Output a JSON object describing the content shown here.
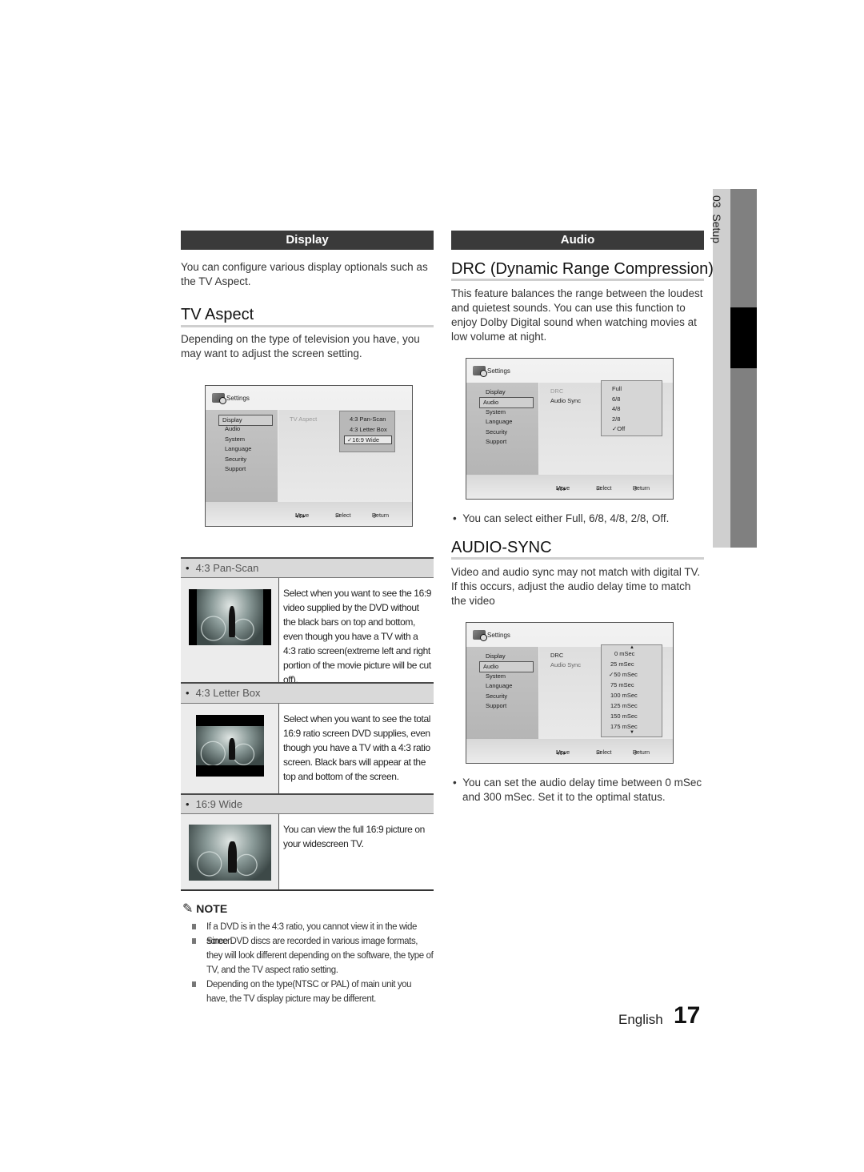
{
  "side_tab": {
    "chapter": "03",
    "label": "Setup"
  },
  "display_section": {
    "bar_label": "Display",
    "intro": "You can configure various display optionals such as the TV Aspect.",
    "tv_aspect": {
      "heading": "TV Aspect",
      "description": "Depending on the type of television you have, you may want to adjust the screen setting.",
      "screen": {
        "title": "Settings",
        "menu": [
          "Display",
          "Audio",
          "System",
          "Language",
          "Security",
          "Support"
        ],
        "selected_menu": "Display",
        "option_label": "TV Aspect",
        "popup_options": [
          "4:3 Pan-Scan",
          "4:3 Letter Box",
          "16:9 Wide"
        ],
        "checked_option": "16:9 Wide",
        "footer": {
          "move": "Move",
          "select": "Select",
          "return": "Return"
        }
      },
      "modes": [
        {
          "label": "4:3 Pan-Scan",
          "description": "Select when you want to see the 16:9 video supplied by the DVD without the black bars on top and bottom, even though you have a TV with a 4:3 ratio screen(extreme left and right portion of the movie picture will be cut off)."
        },
        {
          "label": "4:3 Letter Box",
          "description": "Select when you want to see the total 16:9 ratio screen DVD supplies, even though you have a TV with a 4:3 ratio screen. Black bars will appear at the top and bottom of the screen."
        },
        {
          "label": "16:9 Wide",
          "description": "You can view the full 16:9 picture on your widescreen TV."
        }
      ]
    },
    "note": {
      "title": "NOTE",
      "items": [
        "If a DVD is in the 4:3 ratio, you cannot view it in the wide screen.",
        "Since DVD discs are recorded in various image formats, they will look different depending on the software, the type of TV, and the TV aspect ratio setting.",
        "Depending on the type(NTSC or PAL) of main unit you have, the TV display picture may be different."
      ]
    }
  },
  "audio_section": {
    "bar_label": "Audio",
    "drc": {
      "heading": "DRC (Dynamic Range Compression)",
      "description": "This feature balances the range between the loudest and quietest sounds. You can use this function to enjoy Dolby Digital sound when watching movies at low volume at night.",
      "screen": {
        "title": "Settings",
        "menu": [
          "Display",
          "Audio",
          "System",
          "Language",
          "Security",
          "Support"
        ],
        "selected_menu": "Audio",
        "options": [
          "DRC",
          "Audio Sync"
        ],
        "popup_options": [
          "Full",
          "6/8",
          "4/8",
          "2/8",
          "Off"
        ],
        "checked_option": "Off",
        "footer": {
          "move": "Move",
          "select": "Select",
          "return": "Return"
        }
      },
      "bullet": "You can select either Full, 6/8, 4/8, 2/8, Off."
    },
    "audio_sync": {
      "heading": "AUDIO-SYNC",
      "description": "Video and audio sync may not match with digital TV. If this occurs, adjust the audio delay time to match the video",
      "screen": {
        "title": "Settings",
        "menu": [
          "Display",
          "Audio",
          "System",
          "Language",
          "Security",
          "Support"
        ],
        "selected_menu": "Audio",
        "options": [
          "DRC",
          "Audio Sync"
        ],
        "popup_options": [
          "0 mSec",
          "25 mSec",
          "50 mSec",
          "75 mSec",
          "100 mSec",
          "125 mSec",
          "150 mSec",
          "175 mSec"
        ],
        "checked_option": "50 mSec",
        "footer": {
          "move": "Move",
          "select": "Select",
          "return": "Return"
        }
      },
      "bullet": "You can set the audio delay time between 0 mSec and 300 mSec. Set it to the optimal status."
    }
  },
  "page_footer": {
    "language": "English",
    "page_number": "17"
  }
}
